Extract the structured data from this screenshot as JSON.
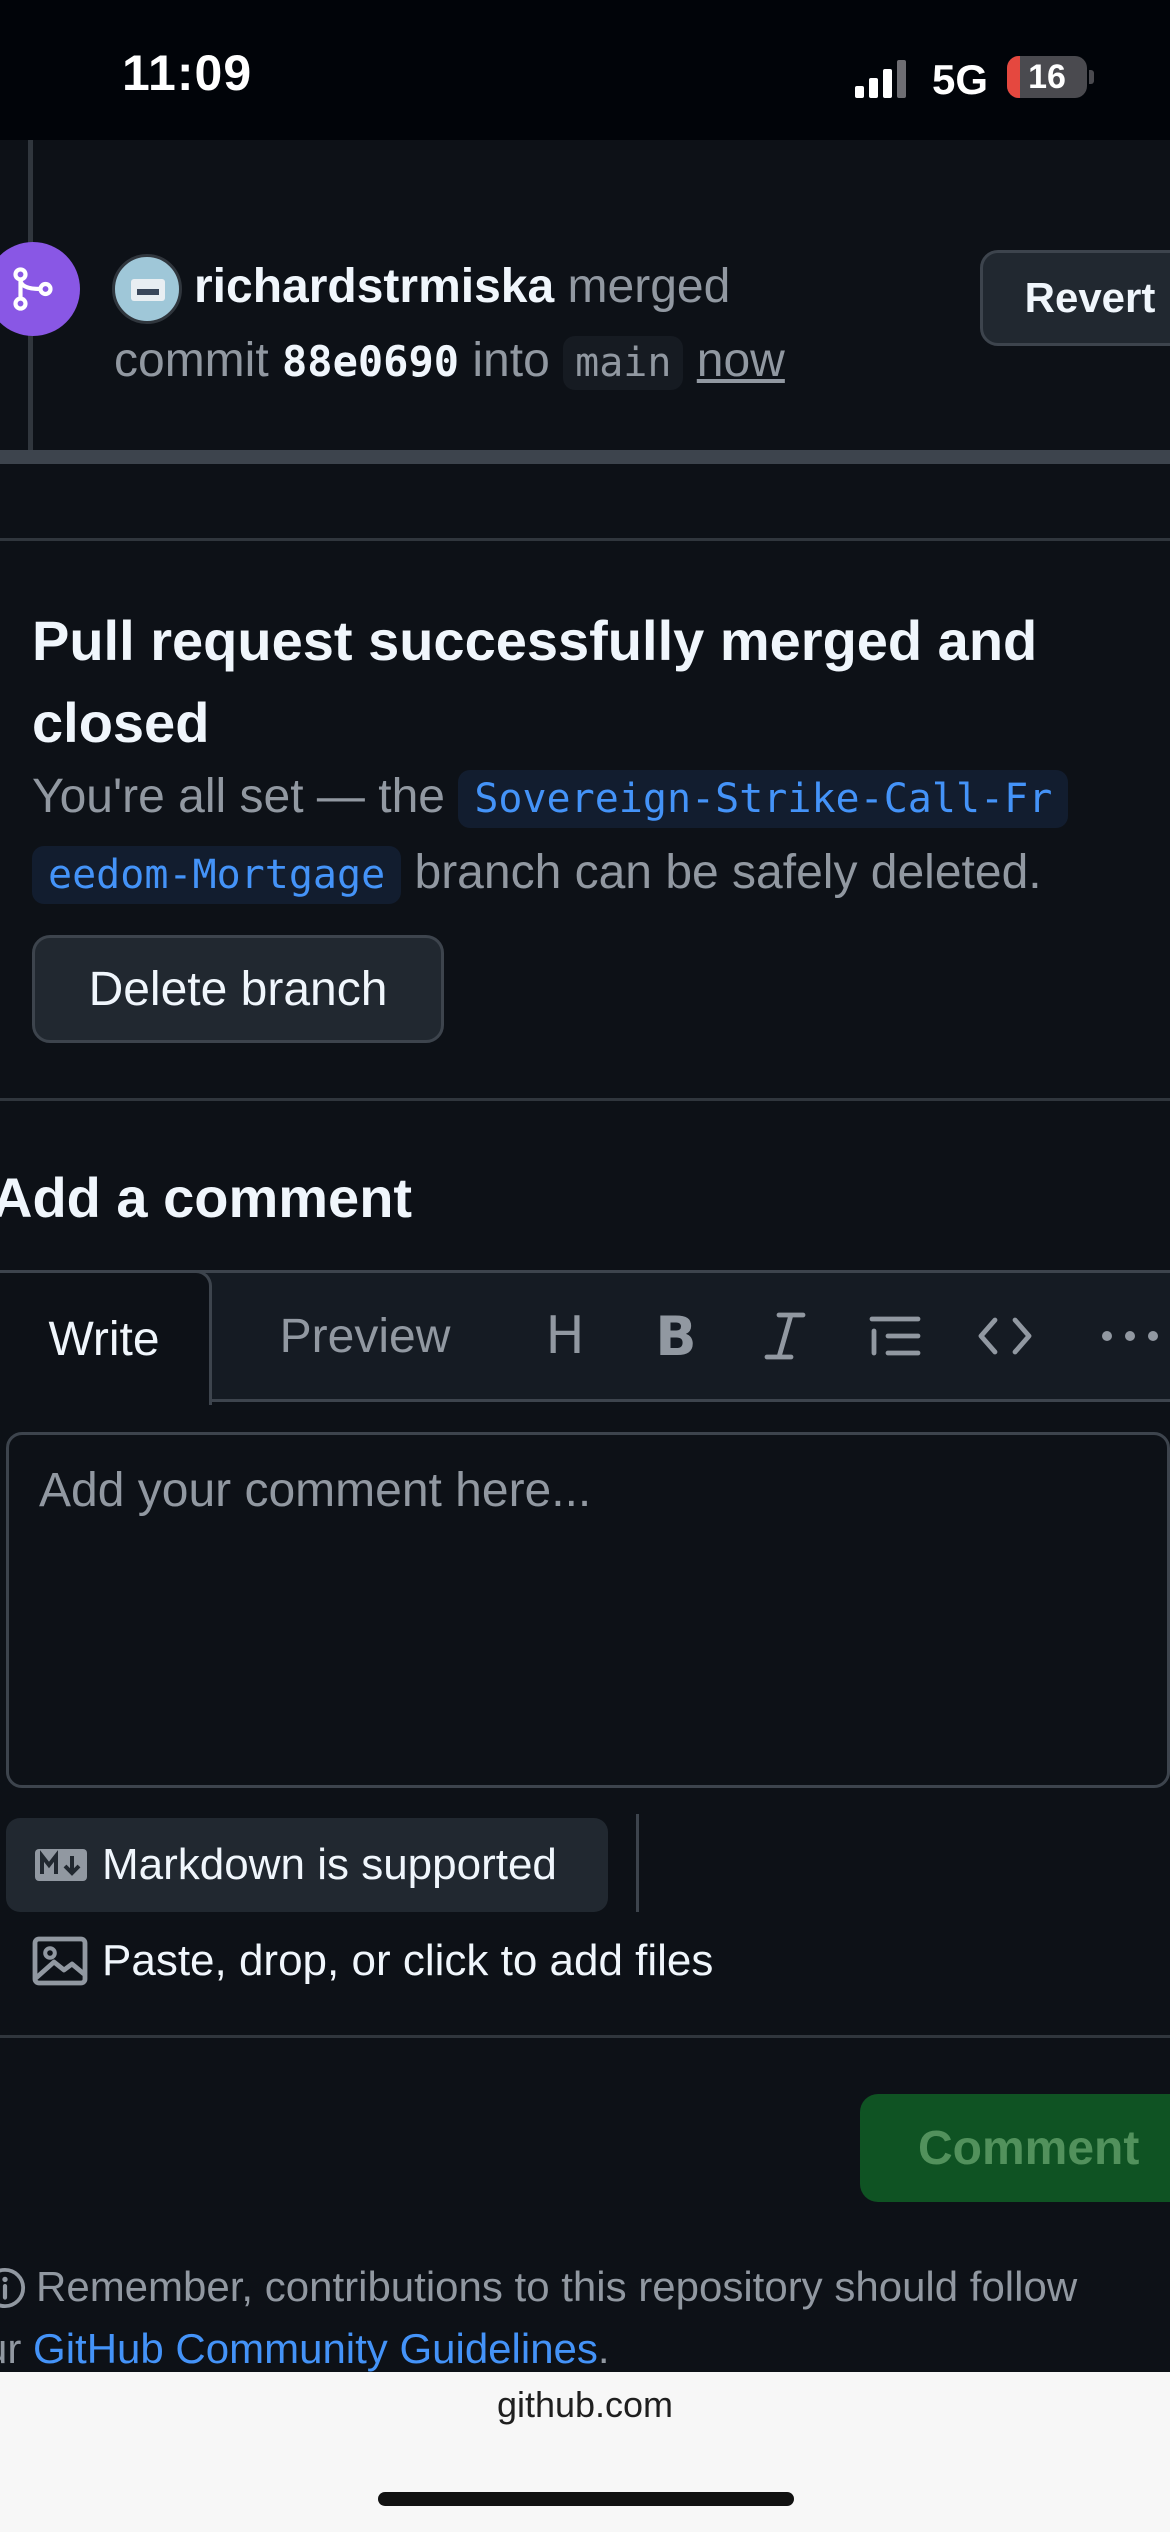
{
  "status_bar": {
    "time": "11:09",
    "network": "5G",
    "battery_level": "16",
    "battery_fraction": 0.16,
    "battery_color": "#e5483f"
  },
  "merge_event": {
    "username": "richardstrmiska",
    "action": "merged",
    "commit_word": "commit",
    "commit_sha": "88e0690",
    "into_word": "into",
    "target_branch": "main",
    "time": "now",
    "revert_label": "Revert",
    "badge_color": "#8957e5"
  },
  "merge_status": {
    "title": "Pull request successfully merged and closed",
    "desc_prefix": "You're all set — the",
    "branch_name_part1": "Sovereign-Strike-Call-Fr",
    "branch_name_part2": "eedom-Mortgage",
    "desc_suffix": "branch can be safely deleted.",
    "delete_branch_label": "Delete branch"
  },
  "comment": {
    "heading": "Add a comment",
    "tabs": {
      "write": "Write",
      "preview": "Preview"
    },
    "toolbar": {
      "heading": "H",
      "bold": "B"
    },
    "placeholder": "Add your comment here...",
    "markdown_label": "Markdown is supported",
    "attach_label": "Paste, drop, or click to add files",
    "submit_label": "Comment",
    "submit_color": "#0f5323"
  },
  "footer": {
    "guidelines_prefix": "Remember, contributions to this repository should follow",
    "guidelines_line2_prefix": "ur",
    "guidelines_link": "GitHub Community Guidelines",
    "guidelines_suffix": "."
  },
  "browser": {
    "url": "github.com"
  }
}
